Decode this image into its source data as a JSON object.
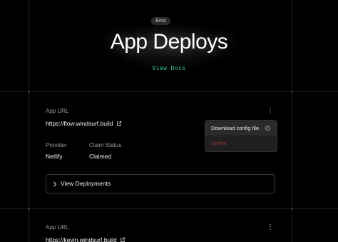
{
  "header": {
    "badge": "Beta",
    "title": "App Deploys",
    "docs_link": "View Docs"
  },
  "deployments": [
    {
      "app_url_label": "App URL",
      "app_url": "https://flow.windsurf.build",
      "provider_label": "Provider",
      "provider": "Netlify",
      "claim_status_label": "Claim Status",
      "claim_status": "Claimed",
      "view_deployments_label": "View Deployments"
    },
    {
      "app_url_label": "App URL",
      "app_url": "https://kevin.windsurf.build"
    }
  ],
  "menu": {
    "items": [
      {
        "label": "Download config file",
        "icon": "info-icon"
      },
      {
        "label": "Delete",
        "disabled": true
      }
    ]
  },
  "colors": {
    "background": "#000000",
    "accent": "#39c9a8",
    "danger_muted": "#8a3a3a"
  }
}
